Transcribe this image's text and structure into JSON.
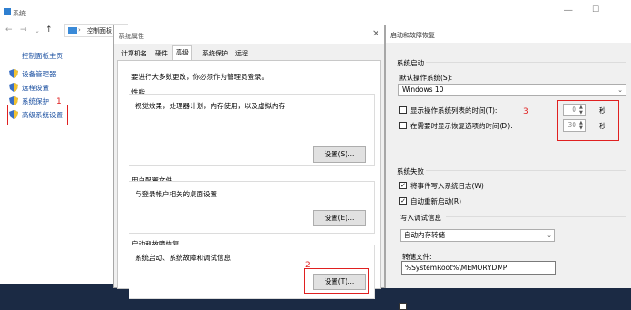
{
  "system_window": {
    "title": "系统",
    "address": "控制面板",
    "minimize": "—",
    "maximize": "☐",
    "sidebar_home": "控制面板主页",
    "sidebar": [
      {
        "label": "设备管理器"
      },
      {
        "label": "远程设置"
      },
      {
        "label": "系统保护"
      },
      {
        "label": "高级系统设置"
      }
    ],
    "annotation": "1"
  },
  "props_dialog": {
    "title": "系统属性",
    "tabs": [
      "计算机名",
      "硬件",
      "高级",
      "系统保护",
      "远程"
    ],
    "active_tab": "高级",
    "admin_note": "要进行大多数更改，你必须作为管理员登录。",
    "performance": {
      "title": "性能",
      "desc": "视觉效果，处理器计划，内存使用，以及虚拟内存",
      "button": "设置(S)..."
    },
    "user_profiles": {
      "title": "用户配置文件",
      "desc": "与登录帐户相关的桌面设置",
      "button": "设置(E)..."
    },
    "startup_recovery": {
      "title": "启动和故障恢复",
      "desc": "系统启动、系统故障和调试信息",
      "button": "设置(T)..."
    },
    "annotation": "2"
  },
  "sr_dialog": {
    "title": "启动和故障恢复",
    "system_startup": "系统启动",
    "default_os_label": "默认操作系统(S):",
    "default_os_value": "Windows 10",
    "show_os_list_label": "显示操作系统列表的时间(T):",
    "show_os_list_value": "0",
    "show_recovery_label": "在需要时显示恢复选项的时间(D):",
    "show_recovery_value": "30",
    "seconds": "秒",
    "annotation": "3",
    "system_failure": "系统失败",
    "write_event_log": "将事件写入系统日志(W)",
    "auto_restart": "自动重新启动(R)",
    "write_debug_info": "写入调试信息",
    "debug_type": "自动内存转储",
    "dump_file_label": "转储文件:",
    "dump_file_value": "%SystemRoot%\\MEMORY.DMP"
  },
  "colors": {
    "annotation": "#e02020",
    "link": "#1a4fa0"
  }
}
